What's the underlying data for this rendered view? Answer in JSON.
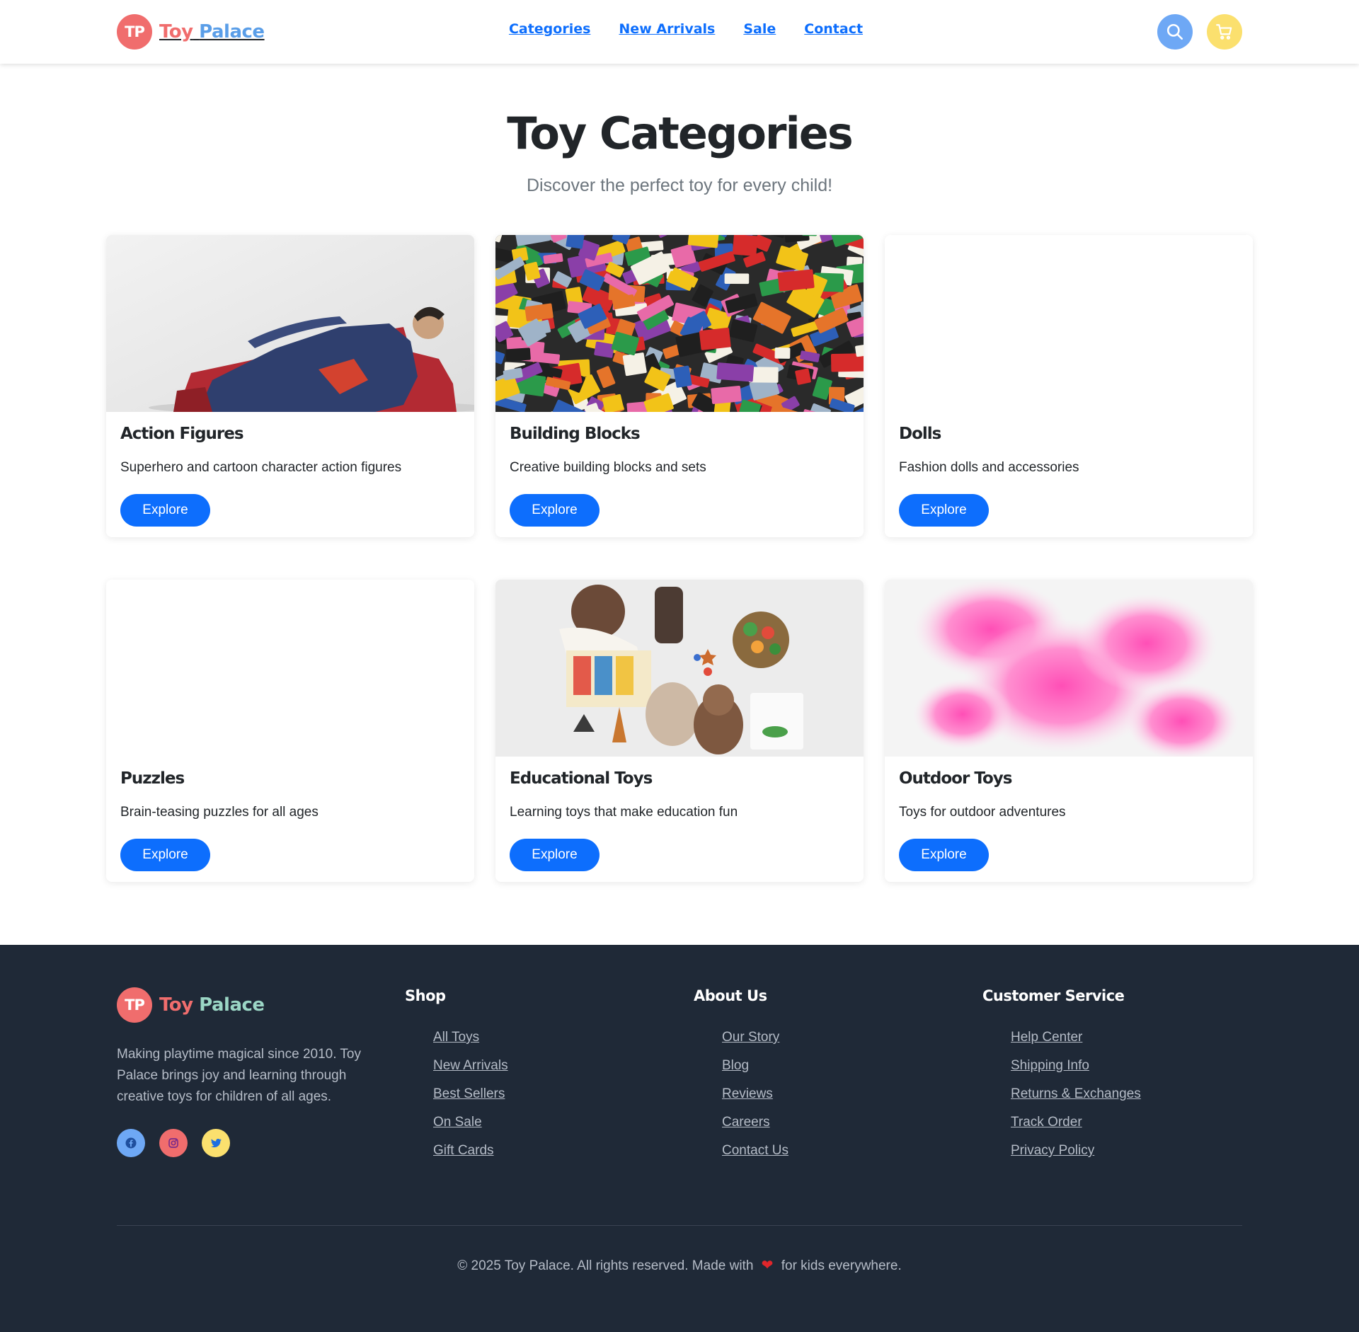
{
  "header": {
    "logo_initials": "TP",
    "brand_part1": "Toy",
    "brand_part2": "Palace",
    "nav": [
      "Categories",
      "New Arrivals",
      "Sale",
      "Contact"
    ],
    "search_icon": "search-icon",
    "cart_icon": "cart-icon"
  },
  "hero": {
    "title": "Toy Categories",
    "subtitle": "Discover the perfect toy for every child!"
  },
  "categories": [
    {
      "title": "Action Figures",
      "description": "Superhero and cartoon character action figures",
      "button": "Explore",
      "image": "superhero-figure-photo"
    },
    {
      "title": "Building Blocks",
      "description": "Creative building blocks and sets",
      "button": "Explore",
      "image": "building-bricks-photo"
    },
    {
      "title": "Dolls",
      "description": "Fashion dolls and accessories",
      "button": "Explore",
      "image": "blank"
    },
    {
      "title": "Puzzles",
      "description": "Brain-teasing puzzles for all ages",
      "button": "Explore",
      "image": "blank"
    },
    {
      "title": "Educational Toys",
      "description": "Learning toys that make education fun",
      "button": "Explore",
      "image": "child-playing-photo"
    },
    {
      "title": "Outdoor Toys",
      "description": "Toys for outdoor adventures",
      "button": "Explore",
      "image": "pink-smoke-photo"
    }
  ],
  "footer": {
    "logo_initials": "TP",
    "brand_part1": "Toy",
    "brand_part2": "Palace",
    "about": "Making playtime magical since 2010. Toy Palace brings joy and learning through creative toys for children of all ages.",
    "social": [
      "facebook-icon",
      "instagram-icon",
      "twitter-icon"
    ],
    "columns": [
      {
        "heading": "Shop",
        "links": [
          "All Toys",
          "New Arrivals",
          "Best Sellers",
          "On Sale",
          "Gift Cards"
        ]
      },
      {
        "heading": "About Us",
        "links": [
          "Our Story",
          "Blog",
          "Reviews",
          "Careers",
          "Contact Us"
        ]
      },
      {
        "heading": "Customer Service",
        "links": [
          "Help Center",
          "Shipping Info",
          "Returns & Exchanges",
          "Track Order",
          "Privacy Policy"
        ]
      }
    ],
    "copyright_prefix": "© 2025 Toy Palace. All rights reserved. Made with",
    "copyright_suffix": "for kids everywhere."
  },
  "colors": {
    "primary": "#0d6efd",
    "coral": "#f06d6d",
    "sky": "#6ea8f5",
    "sun": "#fbe06e",
    "footer_bg": "#1f2937"
  }
}
